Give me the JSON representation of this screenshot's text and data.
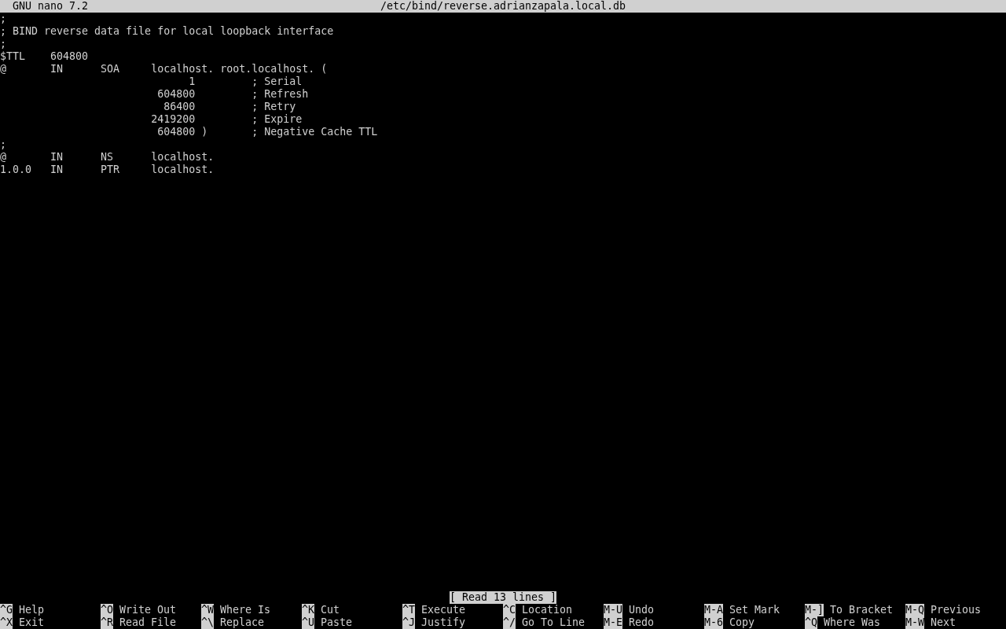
{
  "title_bar": {
    "app": "GNU nano 7.2",
    "file": "/etc/bind/reverse.adrianzapala.local.db"
  },
  "lines": [
    ";",
    "; BIND reverse data file for local loopback interface",
    ";",
    "$TTL    604800",
    "@       IN      SOA     localhost. root.localhost. (",
    "                              1         ; Serial",
    "                         604800         ; Refresh",
    "                          86400         ; Retry",
    "                        2419200         ; Expire",
    "                         604800 )       ; Negative Cache TTL",
    ";",
    "@       IN      NS      localhost.",
    "1.0.0   IN      PTR     localhost."
  ],
  "status_message": "[ Read 13 lines ]",
  "shortcuts": [
    [
      {
        "key": "^G",
        "label": "Help"
      },
      {
        "key": "^O",
        "label": "Write Out"
      },
      {
        "key": "^W",
        "label": "Where Is"
      },
      {
        "key": "^K",
        "label": "Cut"
      },
      {
        "key": "^T",
        "label": "Execute"
      },
      {
        "key": "^C",
        "label": "Location"
      },
      {
        "key": "M-U",
        "label": "Undo"
      },
      {
        "key": "M-A",
        "label": "Set Mark"
      },
      {
        "key": "M-]",
        "label": "To Bracket"
      },
      {
        "key": "M-Q",
        "label": "Previous"
      }
    ],
    [
      {
        "key": "^X",
        "label": "Exit"
      },
      {
        "key": "^R",
        "label": "Read File"
      },
      {
        "key": "^\\",
        "label": "Replace"
      },
      {
        "key": "^U",
        "label": "Paste"
      },
      {
        "key": "^J",
        "label": "Justify"
      },
      {
        "key": "^/",
        "label": "Go To Line"
      },
      {
        "key": "M-E",
        "label": "Redo"
      },
      {
        "key": "M-6",
        "label": "Copy"
      },
      {
        "key": "^Q",
        "label": "Where Was"
      },
      {
        "key": "M-W",
        "label": "Next"
      }
    ]
  ]
}
